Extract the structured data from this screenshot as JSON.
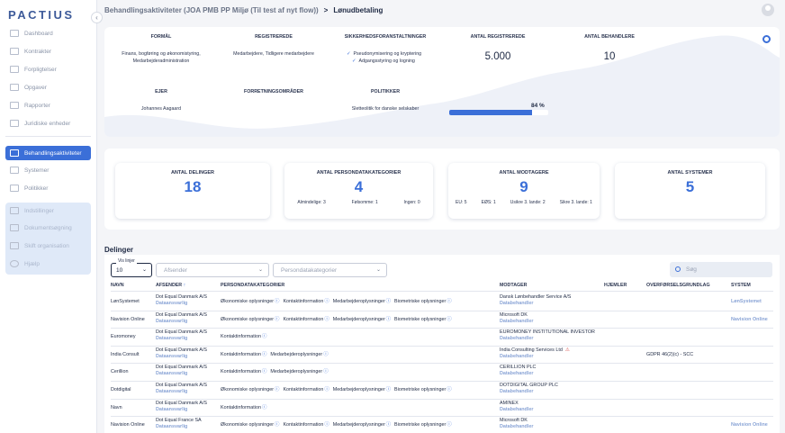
{
  "app": {
    "logo": "PACTIUS"
  },
  "sidebar": {
    "items": [
      {
        "label": "Dashboard",
        "active": false
      },
      {
        "label": "Kontrakter",
        "active": false
      },
      {
        "label": "Forpligtelser",
        "active": false
      },
      {
        "label": "Opgaver",
        "active": false
      },
      {
        "label": "Rapporter",
        "active": false
      },
      {
        "label": "Juridiske enheder",
        "active": false
      },
      {
        "label": "Behandlingsaktiviteter",
        "active": true
      },
      {
        "label": "Systemer",
        "active": false
      },
      {
        "label": "Politikker",
        "active": false
      }
    ],
    "secondary": [
      {
        "label": "Indstillinger"
      },
      {
        "label": "Dokumentsøgning"
      },
      {
        "label": "Skift organisation"
      },
      {
        "label": "Hjælp"
      }
    ]
  },
  "header": {
    "breadcrumb_parent": "Behandlingsaktiviteter (JOA PMB PP Miljø (Til test af nyt flow))",
    "breadcrumb_separator": ">",
    "breadcrumb_current": "Lønudbetaling"
  },
  "summary": {
    "formaal_label": "FORMÅL",
    "formaal_value_1": "Finans, bogføring og økonomistyring,",
    "formaal_value_2": "Medarbejderadministration",
    "registrerede_label": "REGISTREREDE",
    "registrerede_value": "Medarbejdere, Tidligere medarbejdere",
    "sikkerhed_label": "SIKKERHEDSFORANSTALTNINGER",
    "sikkerhed_items": [
      "Pseudonymisering og kryptering",
      "Adgangsstyring og logning"
    ],
    "antal_registrerede_label": "ANTAL REGISTREREDE",
    "antal_registrerede_value": "5.000",
    "antal_behandlere_label": "ANTAL BEHANDLERE",
    "antal_behandlere_value": "10",
    "ejer_label": "EJER",
    "ejer_value": "Johannes Aagaard",
    "forretningsomraader_label": "FORRETNINGSOMRÅDER",
    "politikker_label": "POLITIKKER",
    "politikker_value": "Sletteolitik for danske selskaber",
    "progress_label": "84 %",
    "progress_fraction": 0.84
  },
  "cards": [
    {
      "title": "ANTAL DELINGER",
      "value": "18",
      "subs": []
    },
    {
      "title": "ANTAL PERSONDATAKATEGORIER",
      "value": "4",
      "subs": [
        "Almindelige: 3",
        "Følsomme: 1",
        "Ingen: 0"
      ]
    },
    {
      "title": "ANTAL MODTAGERE",
      "value": "9",
      "subs": [
        "EU: 5",
        "EØS: 1",
        "Usikre 3. lande: 2",
        "Sikre 3. lande: 1"
      ]
    },
    {
      "title": "ANTAL SYSTEMER",
      "value": "5",
      "subs": []
    }
  ],
  "delinger": {
    "title": "Delinger",
    "rows_label": "Vis linjer",
    "rows_value": "10",
    "filter_afsender": "Afsender",
    "filter_kategorier": "Persondatakategorier",
    "search_placeholder": "Søg",
    "headers": [
      "NAVN",
      "AFSENDER",
      "PERSONDATAKATEGORIER",
      "MODTAGER",
      "HJEMLER",
      "OVERFØRSELSGRUNDLAG",
      "SYSTEM"
    ],
    "sort_arrow": "↑",
    "rows": [
      {
        "navn": "LønSystemet",
        "afsender": "Dot Equal Danmark A/S",
        "afsender_role": "Dataansvarlig",
        "kategorier": [
          "Økonomiske oplysninger",
          "Kontaktinformation",
          "Medarbejderoplysninger",
          "Biometriske oplysninger"
        ],
        "modtager": "Dansk Lønbehandler Service A/S",
        "modtager_role": "Databehandler",
        "hjemler": "",
        "grundlag": "",
        "system": "LønSystemet",
        "warn": false
      },
      {
        "navn": "Navision Online",
        "afsender": "Dot Equal Danmark A/S",
        "afsender_role": "Dataansvarlig",
        "kategorier": [
          "Økonomiske oplysninger",
          "Kontaktinformation",
          "Medarbejderoplysninger",
          "Biometriske oplysninger"
        ],
        "modtager": "Microsoft DK",
        "modtager_role": "Databehandler",
        "hjemler": "",
        "grundlag": "",
        "system": "Navision Online",
        "warn": false
      },
      {
        "navn": "Euromoney",
        "afsender": "Dot Equal Danmark A/S",
        "afsender_role": "Dataansvarlig",
        "kategorier": [
          "Kontaktinformation"
        ],
        "modtager": "EUROMONEY INSTITUTIONAL INVESTOR",
        "modtager_role": "Databehandler",
        "hjemler": "",
        "grundlag": "",
        "system": "",
        "warn": false
      },
      {
        "navn": "India Consult",
        "afsender": "Dot Equal Danmark A/S",
        "afsender_role": "Dataansvarlig",
        "kategorier": [
          "Kontaktinformation",
          "Medarbejderoplysninger"
        ],
        "modtager": "India Consulting Services Ltd",
        "modtager_role": "Databehandler",
        "hjemler": "",
        "grundlag": "GDPR 46(2)(c) - SCC",
        "system": "",
        "warn": true
      },
      {
        "navn": "Cerillion",
        "afsender": "Dot Equal Danmark A/S",
        "afsender_role": "Dataansvarlig",
        "kategorier": [
          "Kontaktinformation",
          "Medarbejderoplysninger"
        ],
        "modtager": "CERILLION PLC",
        "modtager_role": "Databehandler",
        "hjemler": "",
        "grundlag": "",
        "system": "",
        "warn": false
      },
      {
        "navn": "Dotdigital",
        "afsender": "Dot Equal Danmark A/S",
        "afsender_role": "Dataansvarlig",
        "kategorier": [
          "Økonomiske oplysninger",
          "Kontaktinformation",
          "Medarbejderoplysninger",
          "Biometriske oplysninger"
        ],
        "modtager": "DOTDIGITAL GROUP PLC",
        "modtager_role": "Databehandler",
        "hjemler": "",
        "grundlag": "",
        "system": "",
        "warn": false
      },
      {
        "navn": "Navn",
        "afsender": "Dot Equal Danmark A/S",
        "afsender_role": "Dataansvarlig",
        "kategorier": [
          "Kontaktinformation"
        ],
        "modtager": "AMINEX",
        "modtager_role": "Databehandler",
        "hjemler": "",
        "grundlag": "",
        "system": "",
        "warn": false
      },
      {
        "navn": "Navision Online",
        "afsender": "Dot Equal France SA",
        "afsender_role": "Dataansvarlig",
        "kategorier": [
          "Økonomiske oplysninger",
          "Kontaktinformation",
          "Medarbejderoplysninger",
          "Biometriske oplysninger"
        ],
        "modtager": "Microsoft DK",
        "modtager_role": "Databehandler",
        "hjemler": "",
        "grundlag": "",
        "system": "Navision Online",
        "warn": false
      }
    ]
  }
}
